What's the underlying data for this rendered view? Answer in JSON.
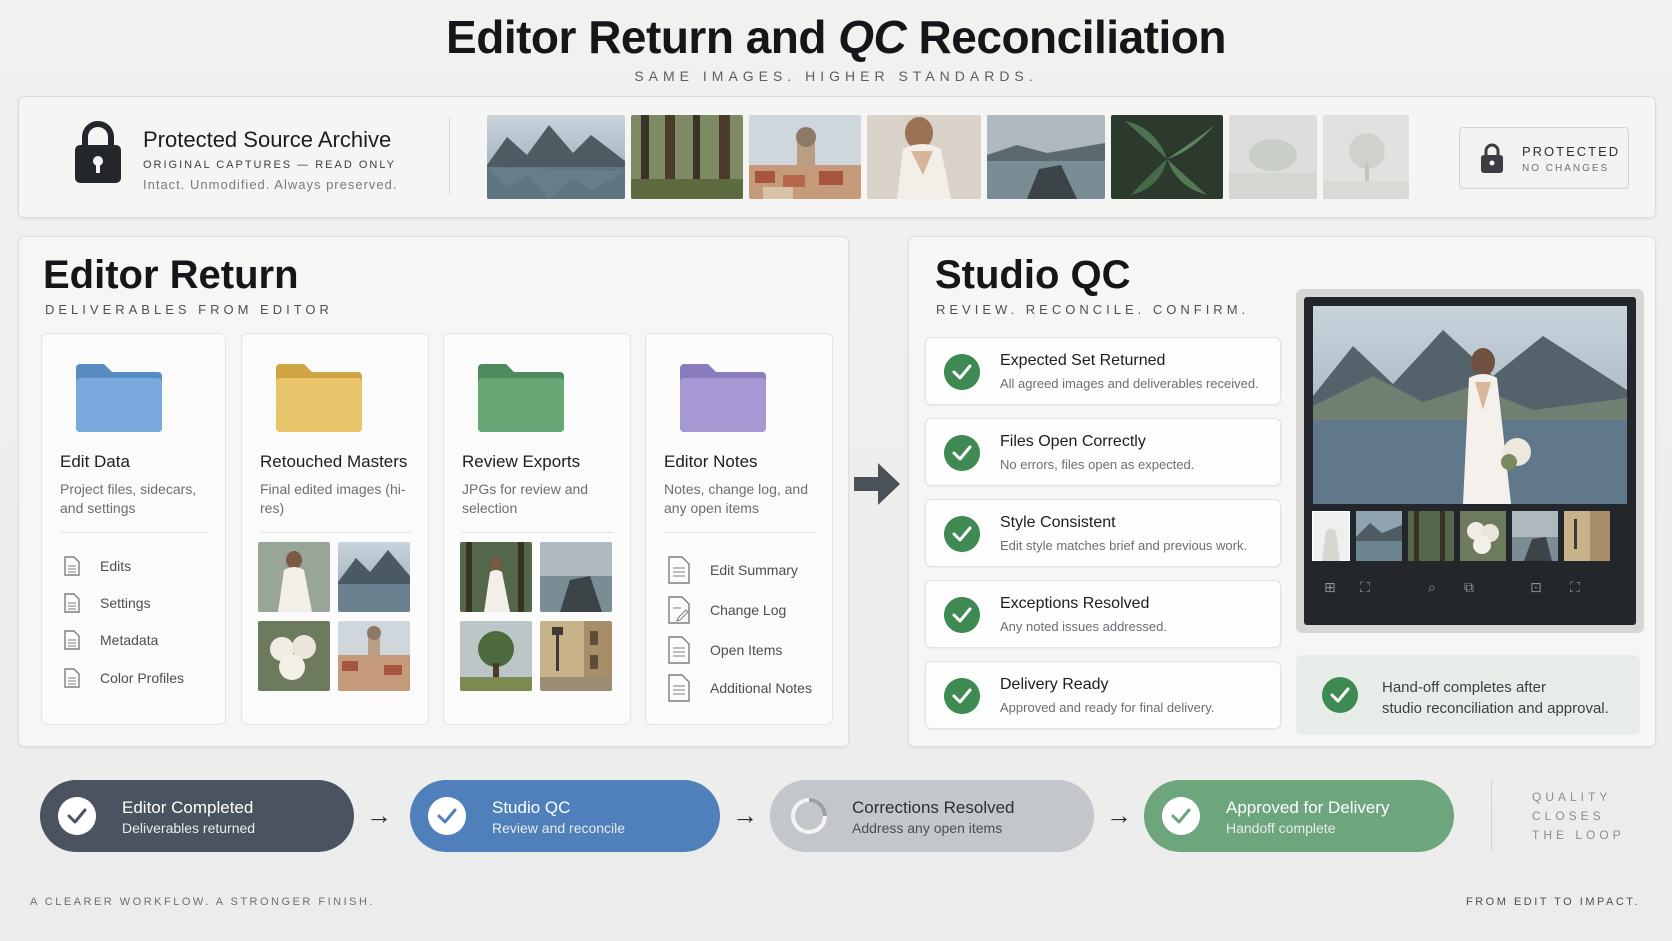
{
  "header": {
    "title_part1": "Editor  Return and ",
    "title_part2": "QC",
    "title_part3": " Reconciliation",
    "subtitle": "SAME IMAGES. HIGHER STANDARDS."
  },
  "archive": {
    "title": "Protected Source Archive",
    "subtitle": "ORIGINAL CAPTURES — READ ONLY",
    "note": "Intact. Unmodified. Always preserved.",
    "badge_title": "PROTECTED",
    "badge_sub": "NO CHANGES",
    "lock_icon": "lock-icon",
    "thumbnails": [
      "mountain-lake",
      "forest",
      "old-town",
      "bride",
      "rocky-coast",
      "leaves",
      "faded-scene",
      "faded-tree"
    ]
  },
  "editor_return": {
    "title": "Editor Return",
    "subtitle": "DELIVERABLES FROM EDITOR",
    "columns": [
      {
        "title": "Edit Data",
        "desc": "Project files, sidecars, and settings",
        "folder_color": "#6f9fd3",
        "items": [
          "Edits",
          "Settings",
          "Metadata",
          "Color Profiles"
        ]
      },
      {
        "title": "Retouched Masters",
        "desc": "Final edited images (hi-res)",
        "folder_color": "#e3bf62"
      },
      {
        "title": "Review Exports",
        "desc": "JPGs for review and selection",
        "folder_color": "#62a474"
      },
      {
        "title": "Editor Notes",
        "desc": "Notes, change log, and any open items",
        "folder_color": "#a394d0",
        "items": [
          "Edit Summary",
          "Change Log",
          "Open Items",
          "Additional Notes"
        ]
      }
    ]
  },
  "studio_qc": {
    "title": "Studio QC",
    "subtitle": "REVIEW. RECONCILE. CONFIRM.",
    "checks": [
      {
        "title": "Expected Set Returned",
        "desc": "All agreed images and deliverables received."
      },
      {
        "title": "Files Open Correctly",
        "desc": "No errors, files open as expected."
      },
      {
        "title": "Style Consistent",
        "desc": "Edit style matches brief and previous work."
      },
      {
        "title": "Exceptions Resolved",
        "desc": "Any noted issues addressed."
      },
      {
        "title": "Delivery Ready",
        "desc": "Approved and ready for final delivery."
      }
    ],
    "handoff_line1": "Hand-off completes after",
    "handoff_line2": "studio reconciliation and approval."
  },
  "steps": [
    {
      "title": "Editor Completed",
      "sub": "Deliverables returned",
      "color": "#4a535f",
      "state": "done"
    },
    {
      "title": "Studio QC",
      "sub": "Review and reconcile",
      "color": "#4f80bb",
      "state": "done"
    },
    {
      "title": "Corrections Resolved",
      "sub": "Address any open items",
      "color": "#c3c7cc",
      "state": "pending"
    },
    {
      "title": "Approved for Delivery",
      "sub": "Handoff complete",
      "color": "#6da67c",
      "state": "done"
    }
  ],
  "loop_text": [
    "QUALITY",
    "CLOSES",
    "THE LOOP"
  ],
  "footer": {
    "left": "A CLEARER WORKFLOW. A STRONGER FINISH.",
    "right": "FROM EDIT TO IMPACT."
  }
}
